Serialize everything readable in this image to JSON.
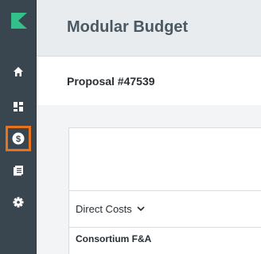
{
  "app": {
    "title": "Modular Budget"
  },
  "proposal": {
    "title": "Proposal #47539"
  },
  "sidebar": {
    "logo": "kuali-logo-icon",
    "items": [
      {
        "name": "home",
        "icon": "home-icon",
        "active": false
      },
      {
        "name": "dashboard",
        "icon": "dashboard-icon",
        "active": false
      },
      {
        "name": "budget",
        "icon": "dollar-icon",
        "active": true
      },
      {
        "name": "documents",
        "icon": "document-icon",
        "active": false
      },
      {
        "name": "settings",
        "icon": "gear-icon",
        "active": false
      }
    ]
  },
  "budget": {
    "section_label": "Direct Costs",
    "first_row_label": "Consortium F&A"
  },
  "colors": {
    "sidebar": "#3a464f",
    "logo": "#33c08a",
    "active_highlight": "#e8731f",
    "header": "#e9ecee",
    "title_text": "#4a5963"
  }
}
